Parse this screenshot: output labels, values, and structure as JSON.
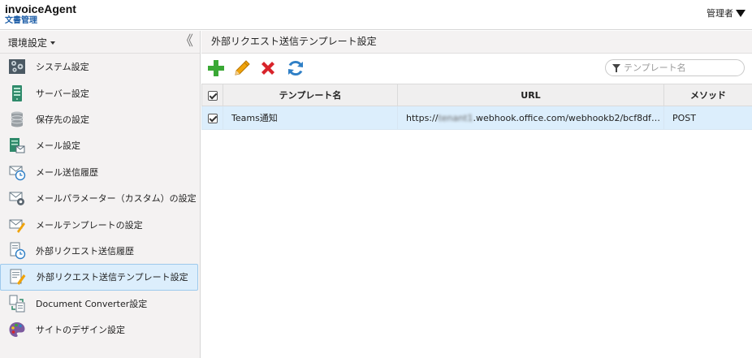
{
  "header": {
    "app_name": "invoiceAgent",
    "app_sub": "文書管理",
    "user_menu_label": "管理者"
  },
  "sidebar": {
    "section_label": "環境設定",
    "collapse_glyph": "《",
    "items": [
      {
        "label": "システム設定",
        "icon": "system-settings-icon"
      },
      {
        "label": "サーバー設定",
        "icon": "server-icon"
      },
      {
        "label": "保存先の設定",
        "icon": "database-icon"
      },
      {
        "label": "メール設定",
        "icon": "mail-settings-icon"
      },
      {
        "label": "メール送信履歴",
        "icon": "mail-history-icon"
      },
      {
        "label": "メールパラメーター（カスタム）の設定",
        "icon": "mail-parameter-icon"
      },
      {
        "label": "メールテンプレートの設定",
        "icon": "mail-template-icon"
      },
      {
        "label": "外部リクエスト送信履歴",
        "icon": "request-history-icon"
      },
      {
        "label": "外部リクエスト送信テンプレート設定",
        "icon": "request-template-icon"
      },
      {
        "label": "Document Converter設定",
        "icon": "document-converter-icon"
      },
      {
        "label": "サイトのデザイン設定",
        "icon": "palette-icon"
      }
    ],
    "active_index": 8
  },
  "main": {
    "title": "外部リクエスト送信テンプレート設定",
    "search_placeholder": "テンプレート名",
    "table": {
      "columns": [
        "テンプレート名",
        "URL",
        "メソッド"
      ],
      "rows": [
        {
          "name": "Teams通知",
          "url_blurred": "tenant1",
          "url_rest": ".webhook.office.com/webhookb2/bcf8dfc⋯",
          "url_prefix": "https://",
          "method": "POST",
          "checked": true
        }
      ]
    }
  },
  "colors": {
    "accent_blue": "#1f5fa8",
    "selected_row": "#dceefc",
    "add_green": "#3aa835",
    "delete_red": "#d8232a",
    "edit_orange": "#f0a30a",
    "refresh_blue": "#2f7fc6"
  }
}
